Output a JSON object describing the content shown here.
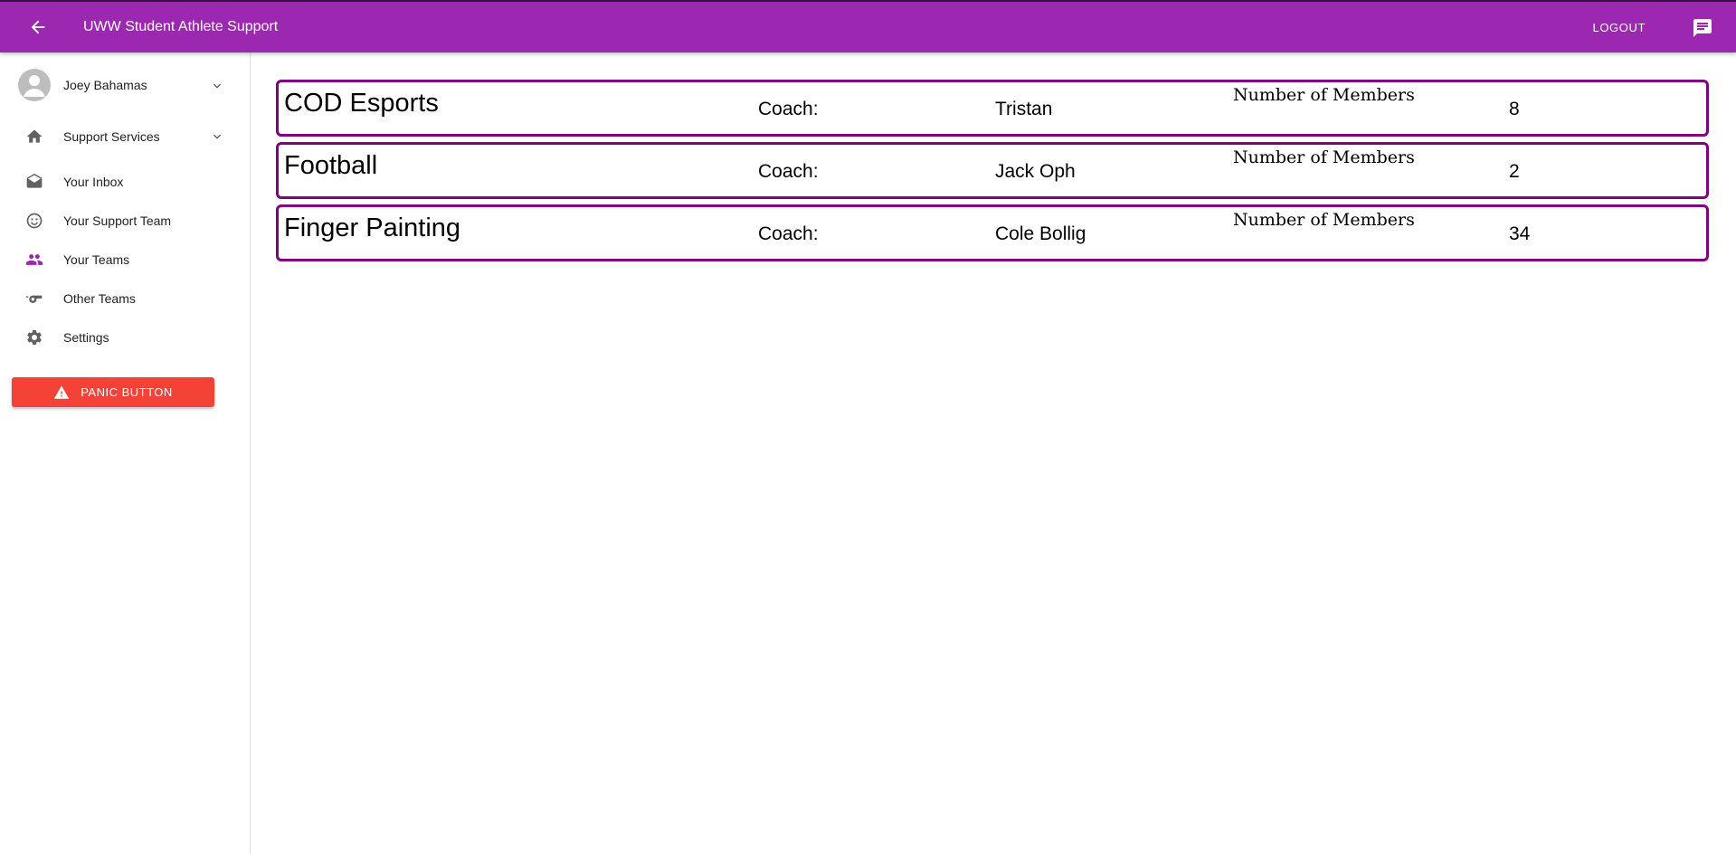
{
  "app": {
    "title": "UWW Student Athlete Support",
    "logout_label": "LOGOUT",
    "brand_color": "#9c27b0",
    "back_icon": "arrow-left-icon",
    "chat_icon": "chat-icon"
  },
  "sidebar": {
    "user": {
      "name": "Joey Bahamas",
      "icon": "account-circle-icon"
    },
    "items": [
      {
        "label": "Support Services",
        "icon": "home-icon"
      },
      {
        "label": "Your Inbox",
        "icon": "drafts-icon"
      },
      {
        "label": "Your Support Team",
        "icon": "smiley-icon"
      },
      {
        "label": "Your Teams",
        "icon": "people-icon",
        "active": true
      },
      {
        "label": "Other Teams",
        "icon": "whistle-icon"
      },
      {
        "label": "Settings",
        "icon": "gear-icon"
      }
    ],
    "panic_label": "PANIC BUTTON",
    "panic_color": "#f44336",
    "active_color": "#9c27b0"
  },
  "teams": [
    {
      "name": "COD Esports",
      "coach_label": "Coach:",
      "coach": "Tristan",
      "members_label": "Number of Members",
      "members": "8"
    },
    {
      "name": "Football",
      "coach_label": "Coach:",
      "coach": "Jack Oph",
      "members_label": "Number of Members",
      "members": "2"
    },
    {
      "name": "Finger Painting",
      "coach_label": "Coach:",
      "coach": "Cole Bollig",
      "members_label": "Number of Members",
      "members": "34"
    }
  ],
  "card_border_color": "#800080"
}
